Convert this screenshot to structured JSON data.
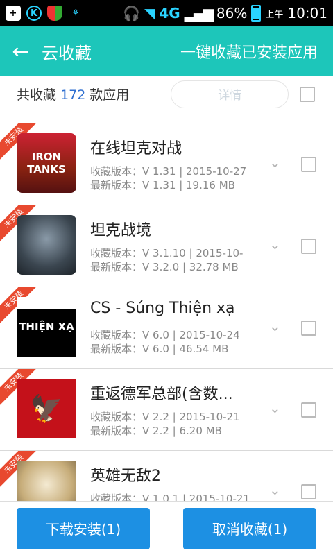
{
  "status_bar": {
    "network": "4G",
    "battery_percent": "86%",
    "am_pm": "上午",
    "time": "10:01",
    "accent_color": "#2ad3ff"
  },
  "header": {
    "title": "云收藏",
    "action": "一键收藏已安装应用"
  },
  "summary": {
    "prefix": "共收藏",
    "count": "172",
    "suffix": "款应用",
    "detail_label": "详情"
  },
  "items": [
    {
      "badge": "未安装",
      "name": "在线坦克对战",
      "icon_text": "IRON TANKS",
      "fav_version": "收藏版本：V 1.31 | 2015-10-27",
      "latest_version": "最新版本：V 1.31 | 19.16 MB"
    },
    {
      "badge": "未安装",
      "name": "坦克战境",
      "icon_text": "",
      "fav_version": "收藏版本：V 3.1.10 | 2015-10-",
      "latest_version": "最新版本：V 3.2.0 | 32.78 MB"
    },
    {
      "badge": "未安装",
      "name": "CS - Súng Thiện xạ",
      "icon_text": "THIỆN XẠ",
      "fav_version": "收藏版本：V 6.0 | 2015-10-24",
      "latest_version": "最新版本：V 6.0 | 46.54 MB"
    },
    {
      "badge": "未安装",
      "name": "重返德军总部(含数...",
      "icon_text": "",
      "fav_version": "收藏版本：V 2.2 | 2015-10-21",
      "latest_version": "最新版本：V 2.2 | 6.20 MB"
    },
    {
      "badge": "未安装",
      "name": "英雄无敌2",
      "icon_text": "",
      "fav_version": "收藏版本：V 1.0.1 | 2015-10-21",
      "latest_version": ""
    }
  ],
  "bottom": {
    "install_button": "下载安装(1)",
    "cancel_button": "取消收藏(1)"
  }
}
